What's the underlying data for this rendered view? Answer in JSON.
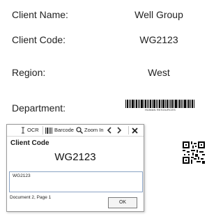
{
  "document": {
    "fields": [
      {
        "label": "Client Name:",
        "value": "Well Group"
      },
      {
        "label": "Client Code:",
        "value": "WG2123"
      },
      {
        "label": "Region:",
        "value": "West"
      },
      {
        "label": "Department:",
        "barcode_caption": "HUMAN RESOURCES"
      }
    ]
  },
  "toolbar": {
    "ocr_label": "OCR",
    "barcode_label": "Barcode",
    "zoom_label": "Zoom In",
    "icons": [
      "text-cursor-icon",
      "barcode-icon",
      "magnifier-icon",
      "chevron-left-icon",
      "chevron-right-icon",
      "close-icon"
    ]
  },
  "popup": {
    "title": "Client Code",
    "recognized_value": "WG2123",
    "input_value": "WG2123",
    "status": "Document 2, Page 1",
    "ok_label": "OK"
  },
  "colors": {
    "input_border": "#8aa3c4",
    "popup_border": "#9a9a9a"
  }
}
